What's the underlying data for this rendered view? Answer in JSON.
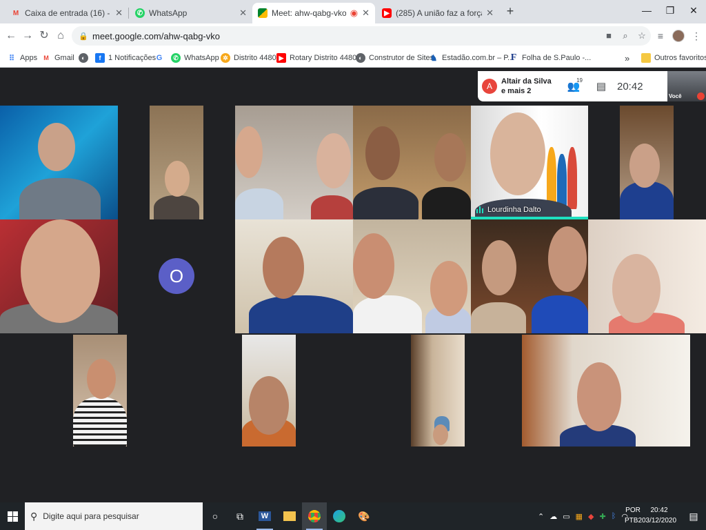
{
  "browser": {
    "tabs": [
      {
        "title": "Caixa de entrada (16) - jlpavam@",
        "icon": "gmail-icon"
      },
      {
        "title": "WhatsApp",
        "icon": "whatsapp-icon"
      },
      {
        "title": "Meet: ahw-qabg-vko",
        "icon": "meet-icon",
        "active": true
      },
      {
        "title": "(285) A união faz a força - YouTu",
        "icon": "youtube-icon"
      }
    ],
    "url": "meet.google.com/ahw-qabg-vko",
    "bookmarks": [
      {
        "label": "Apps",
        "icon": "apps-grid-icon"
      },
      {
        "label": "Gmail",
        "icon": "gmail-icon"
      },
      {
        "label": "",
        "icon": "globe-icon"
      },
      {
        "label": "1 Notificações",
        "icon": "facebook-icon"
      },
      {
        "label": "",
        "icon": "google-icon"
      },
      {
        "label": "WhatsApp",
        "icon": "whatsapp-icon"
      },
      {
        "label": "Distrito 4480",
        "icon": "rotary-icon"
      },
      {
        "label": "Rotary Distrito 4480...",
        "icon": "youtube-icon"
      },
      {
        "label": "Construtor de Sites",
        "icon": "globe-icon"
      },
      {
        "label": "Estadão.com.br – P...",
        "icon": "estadao-icon"
      },
      {
        "label": "Folha de S.Paulo -...",
        "icon": "folha-icon"
      }
    ],
    "other_favorites": "Outros favoritos",
    "overflow": "»"
  },
  "meet": {
    "presenter_initial": "A",
    "presenter_name": "Altair da Silva",
    "presenter_sub": "e mais 2",
    "participant_count": "19",
    "time": "20:42",
    "self_label": "Você",
    "speaker_name": "Lourdinha Dalto",
    "avatar_initial": "O"
  },
  "taskbar": {
    "search_placeholder": "Digite aqui para pesquisar",
    "lang_line1": "POR",
    "lang_line2": "PTB2",
    "time": "20:42",
    "date": "03/12/2020"
  }
}
